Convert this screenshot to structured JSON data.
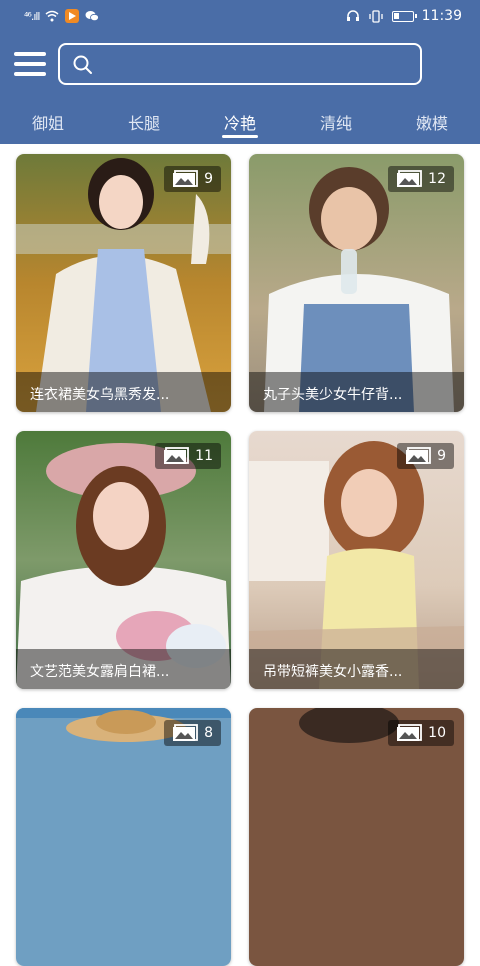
{
  "status": {
    "signal": "⁴⁶.ıll",
    "time": "11:39",
    "battery_level": 0.22
  },
  "search": {
    "placeholder": ""
  },
  "tabs": [
    {
      "label": "御姐",
      "active": false
    },
    {
      "label": "长腿",
      "active": false
    },
    {
      "label": "冷艳",
      "active": true
    },
    {
      "label": "清纯",
      "active": false
    },
    {
      "label": "嫩模",
      "active": false
    }
  ],
  "cards": [
    {
      "title": "连衣裙美女乌黑秀发...",
      "count": "9"
    },
    {
      "title": "丸子头美少女牛仔背...",
      "count": "12"
    },
    {
      "title": "文艺范美女露肩白裙...",
      "count": "11"
    },
    {
      "title": "吊带短裤美女小露香...",
      "count": "9"
    },
    {
      "title": "",
      "count": "8"
    },
    {
      "title": "",
      "count": "10"
    }
  ],
  "colors": {
    "accent": "#4a6da7"
  }
}
